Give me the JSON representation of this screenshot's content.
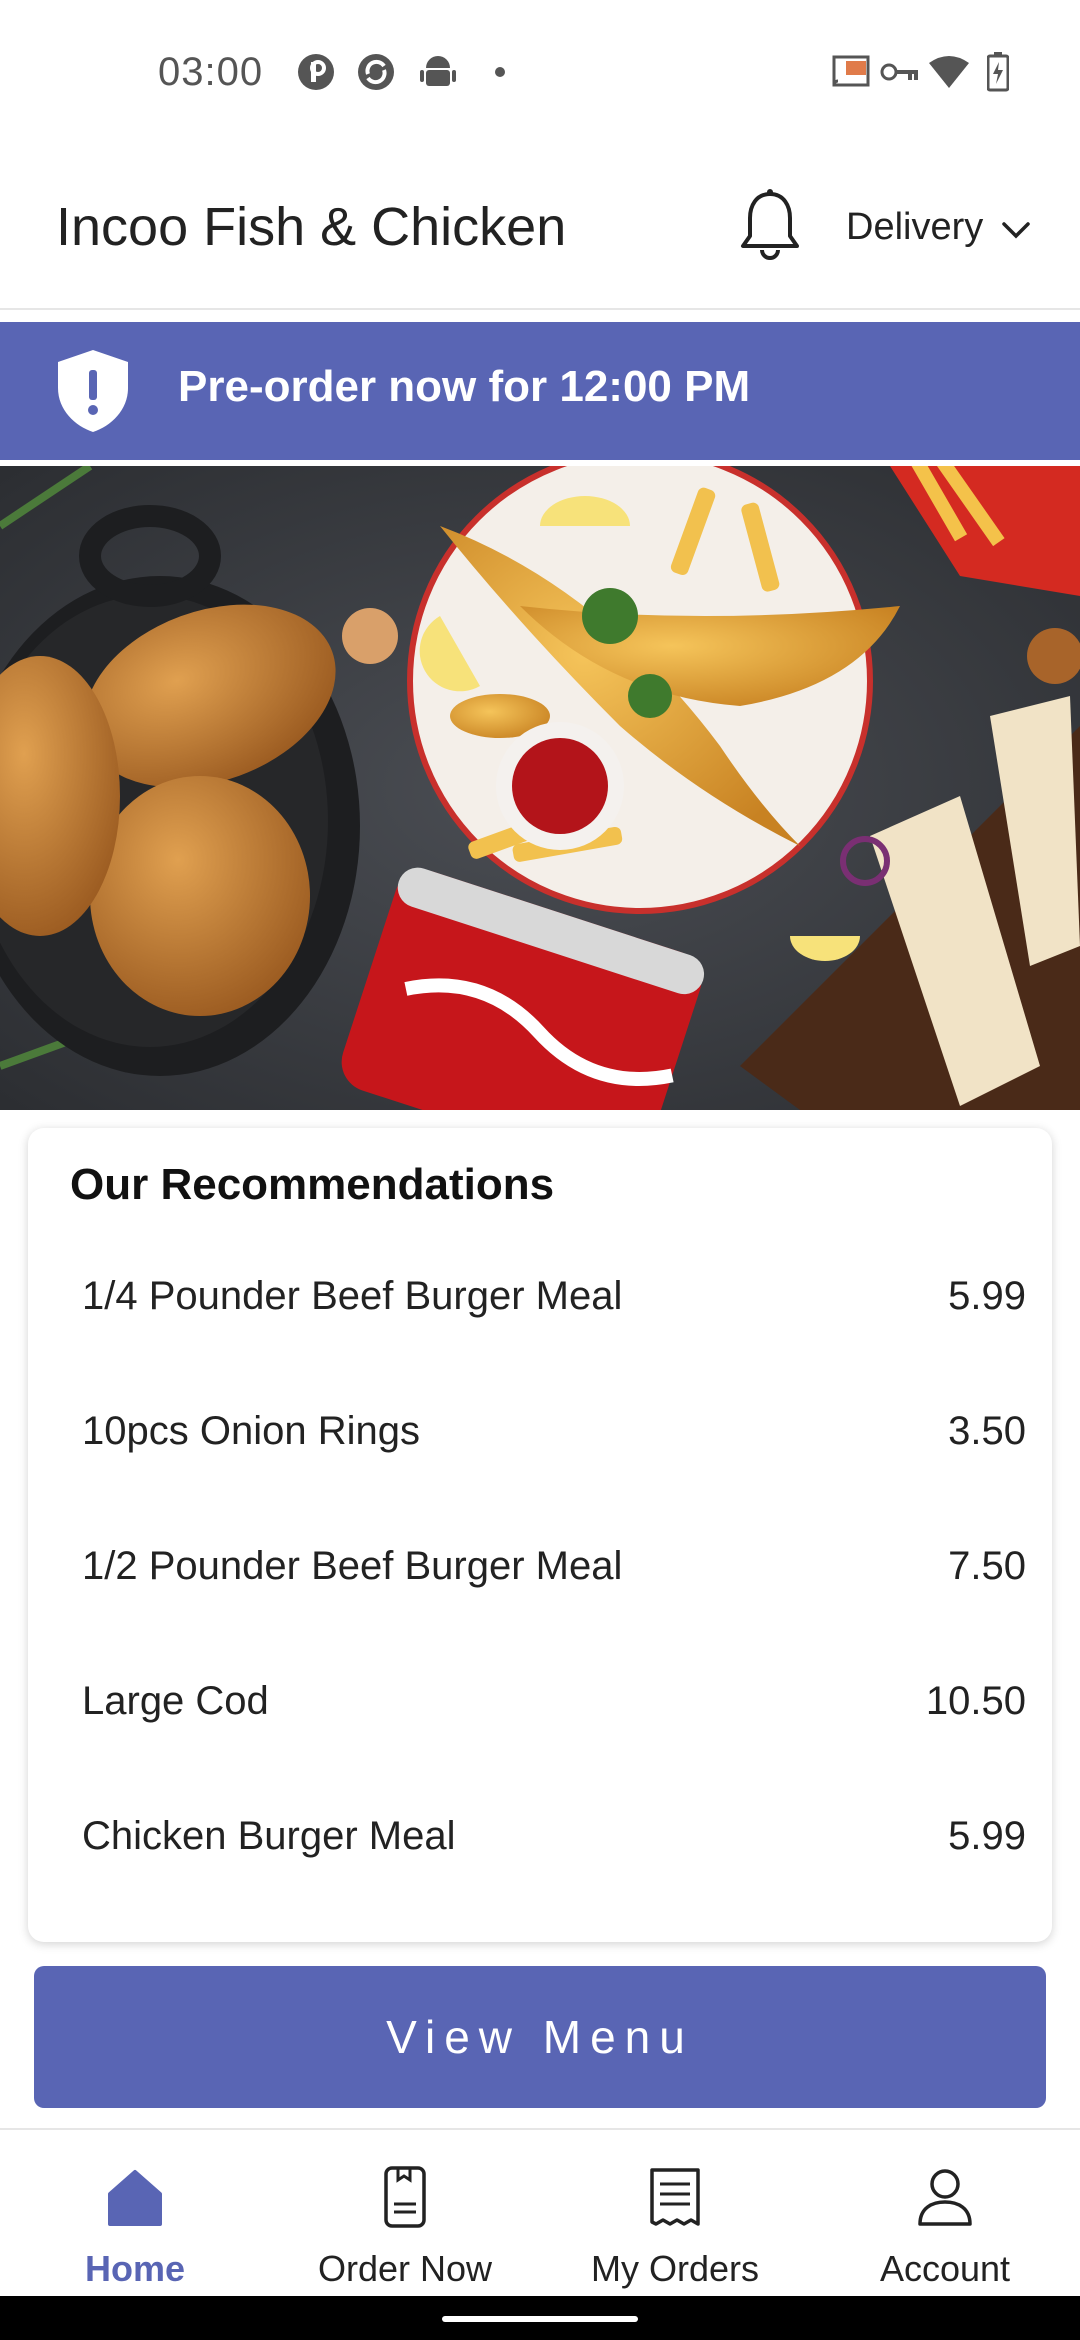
{
  "status_bar": {
    "time": "03:00"
  },
  "header": {
    "title": "Incoo Fish & Chicken",
    "delivery_label": "Delivery"
  },
  "banner": {
    "text": "Pre-order now for 12:00 PM"
  },
  "recommendations": {
    "title": "Our Recommendations",
    "items": [
      {
        "name": "1/4 Pounder Beef Burger Meal",
        "price": "5.99"
      },
      {
        "name": "10pcs Onion Rings",
        "price": "3.50"
      },
      {
        "name": "1/2 Pounder Beef Burger Meal",
        "price": "7.50"
      },
      {
        "name": "Large Cod",
        "price": "10.50"
      },
      {
        "name": "Chicken Burger Meal",
        "price": "5.99"
      }
    ]
  },
  "view_menu_label": "View Menu",
  "bottom_nav": {
    "items": [
      {
        "label": "Home",
        "icon": "home-icon",
        "active": true
      },
      {
        "label": "Order Now",
        "icon": "order-icon"
      },
      {
        "label": "My Orders",
        "icon": "receipt-icon"
      },
      {
        "label": "Account",
        "icon": "account-icon"
      }
    ]
  },
  "colors": {
    "accent": "#5965b4"
  }
}
